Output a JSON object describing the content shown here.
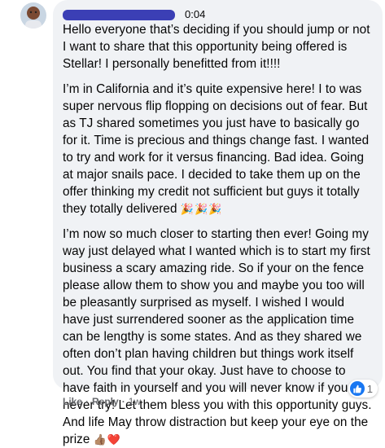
{
  "comment": {
    "timestamp": "0:04",
    "paragraphs": [
      "Hello everyone that’s deciding if you should jump or not I want to share that this opportunity being offered is Stellar! I personally benefitted from it!!!!",
      "I’m in California and it’s quite expensive here! I to was super nervous flip flopping on decisions out of fear. But as TJ shared sometimes you just have to basically go for it. Time is precious and things change fast. I wanted to try and work for it versus financing. Bad idea. Going at major snails pace. I decided to take them up on the offer thinking my credit not sufficient but guys it totally they totally delivered",
      "I’m now so much closer to starting then ever! Going my way just delayed what I wanted which is to start my first business a scary amazing ride. So if your on the fence please allow them to show you and maybe you too will be pleasantly surprised as myself. I wished I would have just surrendered sooner as the application time can be lengthy is some states. And as they shared we often don’t plan having children but things work itself out. You find that your okay. Just have to choose to have faith in yourself and you will never know if you never try! Let them bless you with this opportunity guys. And life May throw distraction but keep your eye on the prize"
    ],
    "party_emojis": "🎉🎉🎉",
    "end_emojis": "👍🏽❤️",
    "reaction_count": "1"
  },
  "actions": {
    "like_label": "Like",
    "separator": "·",
    "reply_label": "Reply",
    "age": "1w"
  },
  "icons": {
    "avatar": "user-avatar",
    "like_reaction": "thumbs-up-icon",
    "love_reaction": "heart-icon"
  },
  "colors": {
    "bubble_bg": "#f0f2f5",
    "meta_text": "#65676b",
    "like_blue": "#1877f2",
    "love_red": "#f33e58"
  }
}
